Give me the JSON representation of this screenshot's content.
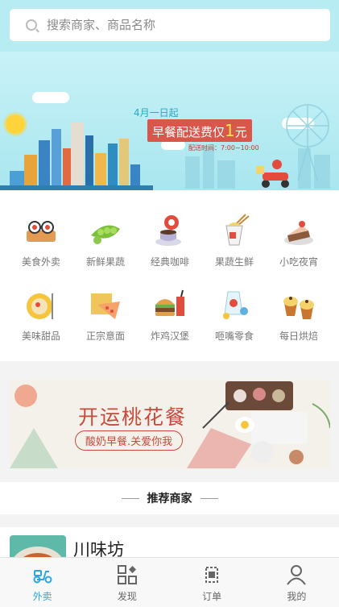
{
  "search": {
    "placeholder": "搜索商家、商品名称",
    "icon": "search-icon"
  },
  "banner": {
    "date": "4月一日起",
    "main_prefix": "早餐配送费仅",
    "main_price": "1",
    "main_suffix": "元",
    "time": "配送时间：7:00~10:00"
  },
  "categories": [
    {
      "label": "美食外卖",
      "icon": "sushi-icon"
    },
    {
      "label": "新鲜果蔬",
      "icon": "peas-icon"
    },
    {
      "label": "经典咖啡",
      "icon": "coffee-icon"
    },
    {
      "label": "果蔬生鲜",
      "icon": "noodle-box-icon"
    },
    {
      "label": "小吃夜宵",
      "icon": "cake-slice-icon"
    },
    {
      "label": "美味甜品",
      "icon": "pizza-plate-icon"
    },
    {
      "label": "正宗意面",
      "icon": "pizza-box-icon"
    },
    {
      "label": "炸鸡汉堡",
      "icon": "burger-icon"
    },
    {
      "label": "咂嘴零食",
      "icon": "snacks-icon"
    },
    {
      "label": "每日烘焙",
      "icon": "cupcake-icon"
    }
  ],
  "promo": {
    "title": "开运桃花餐",
    "subtitle": "酸奶早餐.关爱你我"
  },
  "recommend": {
    "title": "推荐商家"
  },
  "merchant": {
    "name": "川味坊"
  },
  "tabs": [
    {
      "label": "外卖",
      "icon": "scooter-icon",
      "active": true
    },
    {
      "label": "发现",
      "icon": "grid-icon",
      "active": false
    },
    {
      "label": "订单",
      "icon": "order-icon",
      "active": false
    },
    {
      "label": "我的",
      "icon": "user-icon",
      "active": false
    }
  ],
  "colors": {
    "accent": "#2aa6e0",
    "header": "#b7ecf3",
    "promo": "#c74a3c"
  }
}
